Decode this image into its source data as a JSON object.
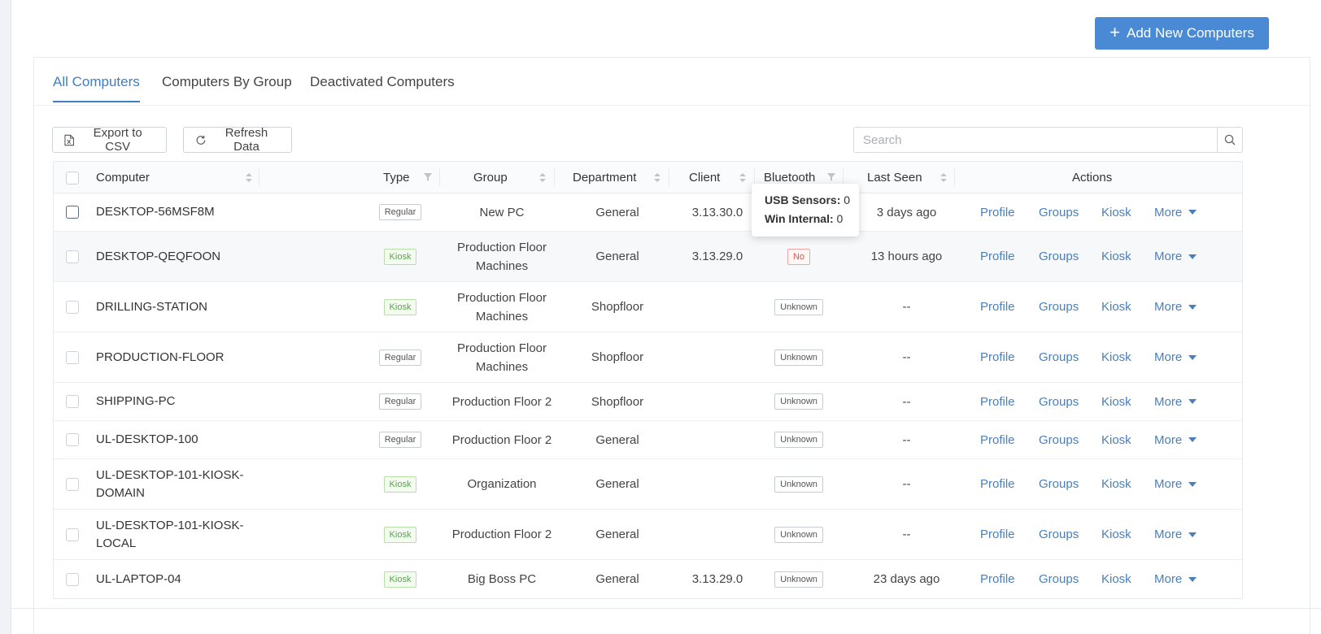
{
  "header": {
    "add_button_label": "Add New Computers"
  },
  "tabs": [
    {
      "label": "All Computers",
      "active": true
    },
    {
      "label": "Computers By Group",
      "active": false
    },
    {
      "label": "Deactivated Computers",
      "active": false
    }
  ],
  "toolbar": {
    "export_label": "Export to CSV",
    "refresh_label": "Refresh Data",
    "search_placeholder": "Search"
  },
  "columns": {
    "computer": "Computer",
    "type": "Type",
    "group": "Group",
    "department": "Department",
    "client": "Client",
    "bluetooth": "Bluetooth",
    "last_seen": "Last Seen",
    "actions": "Actions"
  },
  "rows": [
    {
      "computer": [
        "DESKTOP-56MSF8M"
      ],
      "type": "Regular",
      "group": [
        "New PC"
      ],
      "department": "General",
      "client": "3.13.30.0",
      "bluetooth": "",
      "last_seen": "3 days ago"
    },
    {
      "computer": [
        "DESKTOP-QEQFOON"
      ],
      "type": "Kiosk",
      "group": [
        "Production Floor",
        "Machines"
      ],
      "department": "General",
      "client": "3.13.29.0",
      "bluetooth": "No",
      "last_seen": "13 hours ago"
    },
    {
      "computer": [
        "DRILLING-STATION"
      ],
      "type": "Kiosk",
      "group": [
        "Production Floor",
        "Machines"
      ],
      "department": "Shopfloor",
      "client": "",
      "bluetooth": "Unknown",
      "last_seen": "--"
    },
    {
      "computer": [
        "PRODUCTION-FLOOR"
      ],
      "type": "Regular",
      "group": [
        "Production Floor",
        "Machines"
      ],
      "department": "Shopfloor",
      "client": "",
      "bluetooth": "Unknown",
      "last_seen": "--"
    },
    {
      "computer": [
        "SHIPPING-PC"
      ],
      "type": "Regular",
      "group": [
        "Production Floor 2"
      ],
      "department": "Shopfloor",
      "client": "",
      "bluetooth": "Unknown",
      "last_seen": "--"
    },
    {
      "computer": [
        "UL-DESKTOP-100"
      ],
      "type": "Regular",
      "group": [
        "Production Floor 2"
      ],
      "department": "General",
      "client": "",
      "bluetooth": "Unknown",
      "last_seen": "--"
    },
    {
      "computer": [
        "UL-DESKTOP-101-KIOSK-",
        "DOMAIN"
      ],
      "type": "Kiosk",
      "group": [
        "Organization"
      ],
      "department": "General",
      "client": "",
      "bluetooth": "Unknown",
      "last_seen": "--"
    },
    {
      "computer": [
        "UL-DESKTOP-101-KIOSK-",
        "LOCAL"
      ],
      "type": "Kiosk",
      "group": [
        "Production Floor 2"
      ],
      "department": "General",
      "client": "",
      "bluetooth": "Unknown",
      "last_seen": "--"
    },
    {
      "computer": [
        "UL-LAPTOP-04"
      ],
      "type": "Kiosk",
      "group": [
        "Big Boss PC"
      ],
      "department": "General",
      "client": "3.13.29.0",
      "bluetooth": "Unknown",
      "last_seen": "23 days ago"
    }
  ],
  "actions": {
    "profile": "Profile",
    "groups": "Groups",
    "kiosk": "Kiosk",
    "more": "More"
  },
  "tooltip": {
    "usb_label": "USB Sensors:",
    "usb_value": "0",
    "win_label": "Win Internal:",
    "win_value": "0"
  },
  "colors": {
    "primary": "#4a8ad4",
    "link": "#4a7fbb",
    "kiosk_green": "#52a84b",
    "no_red": "#d9534f"
  }
}
